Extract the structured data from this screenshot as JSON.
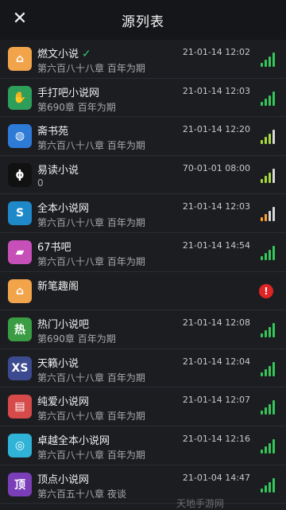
{
  "header": {
    "title": "源列表",
    "close_glyph": "✕"
  },
  "sources": [
    {
      "name": "燃文小说",
      "checked": true,
      "sub": "第六百八十八章 百年为期",
      "time": "21-01-14 12:02",
      "signal": 4,
      "logo": "house-book-icon",
      "logo_text": "⌂",
      "color": "#f2a44b"
    },
    {
      "name": "手打吧小说网",
      "sub": "第690章 百年为期",
      "time": "21-01-14 12:03",
      "signal": 4,
      "logo": "runner-icon",
      "logo_text": "✋",
      "color": "#2e9e5b"
    },
    {
      "name": "斋书苑",
      "sub": "第六百八十八章 百年为期",
      "time": "21-01-14 12:20",
      "signal": 3,
      "logo": "bottle-icon",
      "logo_text": "◍",
      "color": "#2d7bd6"
    },
    {
      "name": "易读小说",
      "sub": "0",
      "time": "70-01-01 08:00",
      "signal": 3,
      "logo": "phi-icon",
      "logo_text": "ϕ",
      "color": "#111"
    },
    {
      "name": "全本小说网",
      "sub": "第六百八十八章 百年为期",
      "time": "21-01-14 12:03",
      "signal": 2,
      "logo": "wave-s-icon",
      "logo_text": "S",
      "color": "#1e88c8"
    },
    {
      "name": "67书吧",
      "sub": "第六百八十八章 百年为期",
      "time": "21-01-14 14:54",
      "signal": 4,
      "logo": "colorful-book-icon",
      "logo_text": "▰",
      "color": "#c74fb8"
    },
    {
      "name": "新笔趣阁",
      "sub": "",
      "time": "",
      "signal": 0,
      "error": true,
      "logo": "house-book-icon",
      "logo_text": "⌂",
      "color": "#f2a44b"
    },
    {
      "name": "热门小说吧",
      "sub": "第690章 百年为期",
      "time": "21-01-14 12:08",
      "signal": 4,
      "logo": "hot-char-icon",
      "logo_text": "热",
      "color": "#3a9d43"
    },
    {
      "name": "天籁小说",
      "sub": "第六百八十八章 百年为期",
      "time": "21-01-14 12:04",
      "signal": 4,
      "logo": "xs-ring-icon",
      "logo_text": "XS",
      "color": "#3c4a8f"
    },
    {
      "name": "纯爱小说网",
      "sub": "第六百八十八章 百年为期",
      "time": "21-01-14 12:07",
      "signal": 4,
      "logo": "open-book-icon",
      "logo_text": "▤",
      "color": "#d64a4a"
    },
    {
      "name": "卓越全本小说网",
      "sub": "第六百八十八章 百年为期",
      "time": "21-01-14 12:16",
      "signal": 4,
      "logo": "ring-icon",
      "logo_text": "◎",
      "color": "#2fb3d6"
    },
    {
      "name": "顶点小说网",
      "sub": "第六百五十八章 夜谈",
      "time": "21-01-04 14:47",
      "signal": 4,
      "logo": "ding-char-icon",
      "logo_text": "顶",
      "color": "#7a3fb8"
    }
  ],
  "watermark": "天地手游网"
}
